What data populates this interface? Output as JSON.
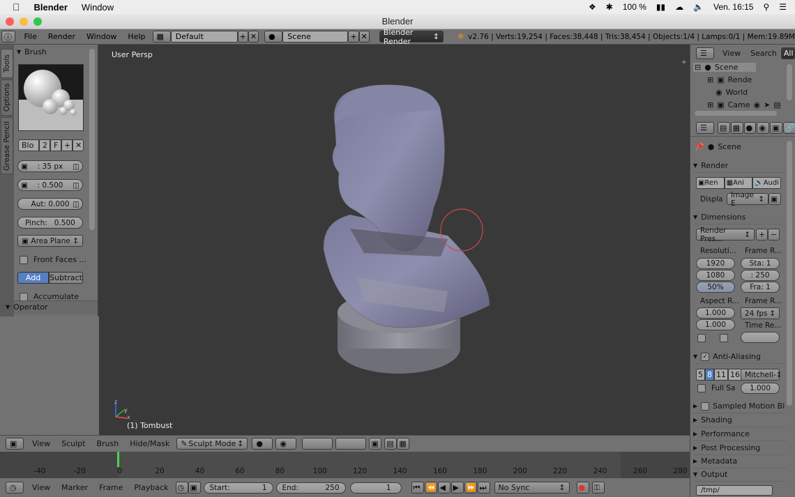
{
  "macbar": {
    "app": "Blender",
    "menu": "Window",
    "battery": "100 %",
    "clock": "Ven. 16:15"
  },
  "window": {
    "title": "Blender"
  },
  "infobar": {
    "menus": [
      "File",
      "Render",
      "Window",
      "Help"
    ],
    "layout": "Default",
    "scene": "Scene",
    "engine": "Blender Render",
    "stats": "v2.76 | Verts:19,254 | Faces:38,448 | Tris:38,454 | Objects:1/4 | Lamps:0/1 | Mem:19.89M"
  },
  "tabs": [
    "Tools",
    "Options",
    "Grease Pencil"
  ],
  "brush": {
    "title": "Brush",
    "name": "Blo",
    "users": "2",
    "fake": "F",
    "radius": ": 35 px",
    "strength": ": 0.500",
    "autosmooth": "Aut: 0.000",
    "pinch_label": "Pinch:",
    "pinch": "0.500",
    "plane": "Area Plane",
    "front_faces": "Front Faces ...",
    "add": "Add",
    "subtract": "Subtract",
    "accumulate": "Accumulate"
  },
  "operator": {
    "title": "Operator"
  },
  "viewport": {
    "label": "User Persp",
    "object": "(1) Tombust",
    "axes": {
      "z": "z",
      "y": "y",
      "x": "x"
    }
  },
  "vp_header": {
    "menus": [
      "View",
      "Sculpt",
      "Brush",
      "Hide/Mask"
    ],
    "mode": "Sculpt Mode"
  },
  "timeline": {
    "ticks": [
      "-40",
      "-20",
      "0",
      "20",
      "40",
      "60",
      "80",
      "100",
      "120",
      "140",
      "160",
      "180",
      "200",
      "220",
      "240",
      "260",
      "280"
    ],
    "current": 0
  },
  "tl_header": {
    "menus": [
      "View",
      "Marker",
      "Frame",
      "Playback"
    ],
    "start": "Start:",
    "start_val": "1",
    "end": "End:",
    "end_val": "250",
    "current": "1",
    "sync": "No Sync"
  },
  "outliner": {
    "view": "View",
    "search": "Search",
    "all": "All",
    "items": [
      "Scene",
      "Rende",
      "World",
      "Came"
    ]
  },
  "props": {
    "scene": "Scene",
    "render": "Render",
    "ren": "Ren",
    "ani": "Ani",
    "audi": "Audi",
    "display_label": "Displa",
    "display": "Image E",
    "dimensions": "Dimensions",
    "presets": "Render Pres...",
    "resolution": "Resoluti...",
    "frame_range": "Frame R...",
    "res_x": "1920",
    "res_y": "1080",
    "res_pct": "50%",
    "start": "Sta: 1",
    "end": ": 250",
    "step": "Fra: 1",
    "aspect": "Aspect R...",
    "frame_rate": "Frame R...",
    "asp_x": "1.000",
    "asp_y": "1.000",
    "fps": "24 fps",
    "time_remap": "Time Re...",
    "aa": "Anti-Aliasing",
    "aa_samples": [
      "5",
      "8",
      "11",
      "16"
    ],
    "aa_filter": "Mitchell-",
    "full_sample": "Full Sa",
    "filter_size": "1.000",
    "motion_blur": "Sampled Motion Bl",
    "shading": "Shading",
    "performance": "Performance",
    "post": "Post Processing",
    "metadata": "Metadata",
    "output": "Output",
    "output_path": "/tmp/"
  }
}
